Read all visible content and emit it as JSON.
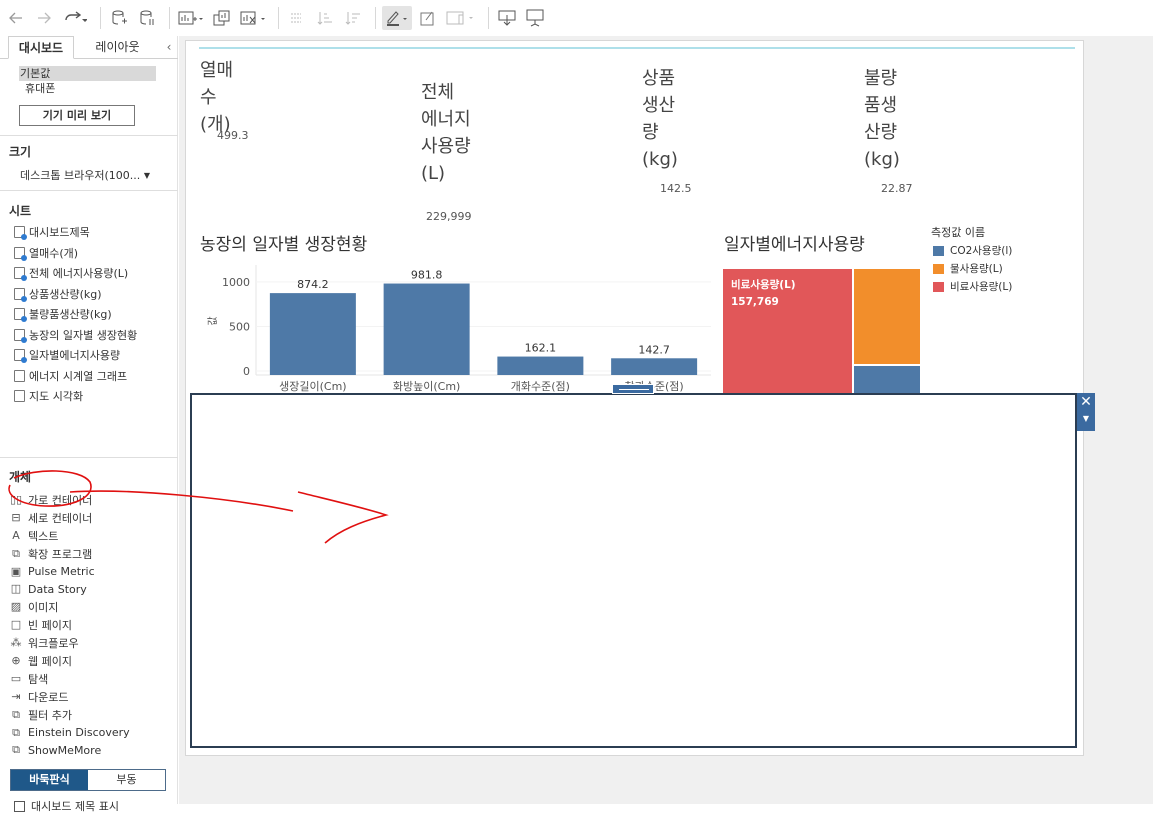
{
  "sidebar": {
    "tabs": [
      "대시보드",
      "레이아웃"
    ],
    "devices": [
      "기본값",
      "휴대폰"
    ],
    "preview_button": "기기 미리 보기",
    "size_title": "크기",
    "size_value": "데스크톱 브라우저(100...",
    "sheets_title": "시트",
    "sheets": [
      "대시보드제목",
      "열매수(개)",
      "전체 에너지사용량(L)",
      "상품생산량(kg)",
      "불량품생산량(kg)",
      "농장의 일자별 생장현황",
      "일자별에너지사용량",
      "에너지 시계열 그래프",
      "지도 시각화"
    ],
    "objects_title": "개체",
    "objects": [
      {
        "label": "가로 컨테이너",
        "icon": "horizontal-container-icon"
      },
      {
        "label": "세로 컨테이너",
        "icon": "vertical-container-icon"
      },
      {
        "label": "텍스트",
        "icon": "text-icon"
      },
      {
        "label": "확장 프로그램",
        "icon": "extension-icon"
      },
      {
        "label": "Pulse Metric",
        "icon": "pulse-icon"
      },
      {
        "label": "Data Story",
        "icon": "book-icon"
      },
      {
        "label": "이미지",
        "icon": "image-icon"
      },
      {
        "label": "빈 페이지",
        "icon": "blank-icon"
      },
      {
        "label": "워크플로우",
        "icon": "workflow-icon"
      },
      {
        "label": "웹 페이지",
        "icon": "globe-icon"
      },
      {
        "label": "탐색",
        "icon": "navigation-icon"
      },
      {
        "label": "다운로드",
        "icon": "download-icon"
      },
      {
        "label": "필터 추가",
        "icon": "filter-icon"
      },
      {
        "label": "Einstein Discovery",
        "icon": "einstein-icon"
      },
      {
        "label": "ShowMeMore",
        "icon": "showmemore-icon"
      }
    ],
    "layout_toggle": [
      "바둑판식",
      "부동"
    ],
    "show_title": "대시보드 제목 표시"
  },
  "kpis": [
    {
      "label": "열매\n수\n(개)",
      "value": "499.3"
    },
    {
      "label": "전체\n에너지\n사용량\n(L)",
      "value": "229,999"
    },
    {
      "label": "상품\n생산\n량\n(kg)",
      "value": "142.5"
    },
    {
      "label": "불량\n품생\n산량\n(kg)",
      "value": "22.87"
    }
  ],
  "bar_chart": {
    "title": "농장의 일자별 생장현황",
    "ylabel": "값"
  },
  "treemap": {
    "title": "일자별에너지사용량",
    "legend_title": "측정값 이름",
    "legend": [
      {
        "name": "CO2사용량(l)",
        "color": "#4e79a7"
      },
      {
        "name": "물사용량(L)",
        "color": "#f28e2b"
      },
      {
        "name": "비료사용량(L)",
        "color": "#e15759"
      }
    ],
    "cell_label": "비료사용량(L)",
    "cell_value": "157,769"
  },
  "chart_data": {
    "type": "bar",
    "categories": [
      "생장길이(Cm)",
      "화방높이(Cm)",
      "개화수준(점)",
      "착과수준(점)"
    ],
    "values": [
      874.2,
      981.8,
      162.1,
      142.7
    ],
    "value_labels": [
      "874.2",
      "981.8",
      "162.1",
      "142.7"
    ],
    "yticks": [
      "0",
      "500",
      "1000"
    ],
    "ylim": [
      0,
      1100
    ],
    "ylabel": "값",
    "color": "#4e79a7"
  }
}
